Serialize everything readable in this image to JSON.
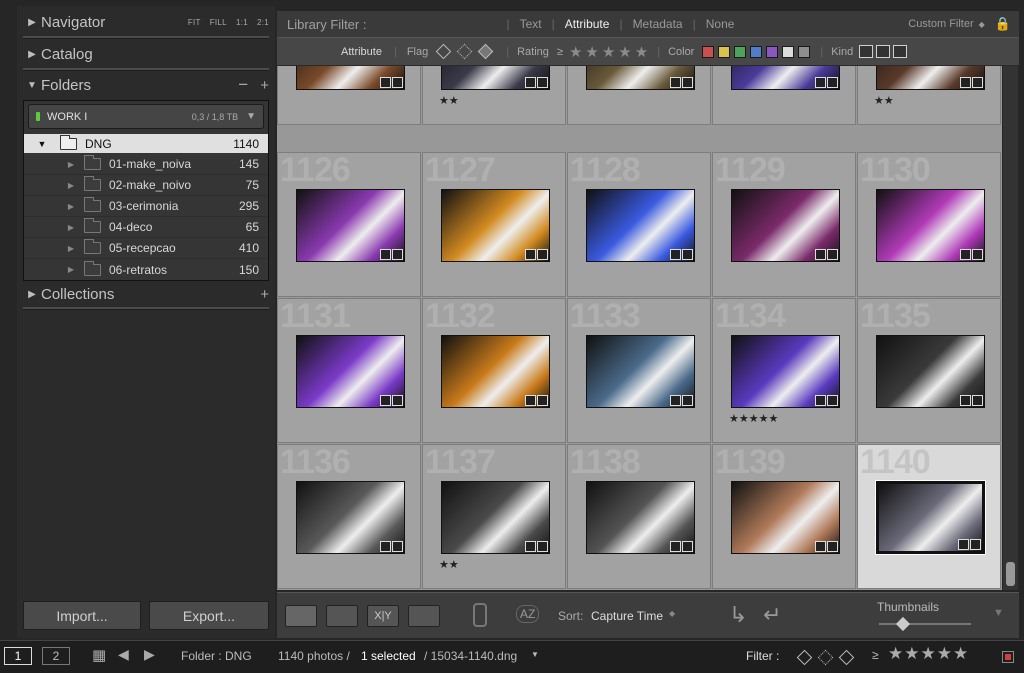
{
  "nav": {
    "navigator": "Navigator",
    "nav_opts": [
      "FIT",
      "FILL",
      "1:1",
      "2:1"
    ],
    "catalog": "Catalog",
    "folders": "Folders",
    "collections": "Collections"
  },
  "volume": {
    "name": "WORK I",
    "size": "0,3 / 1,8 TB"
  },
  "root_folder": {
    "name": "DNG",
    "count": "1140"
  },
  "subfolders": [
    {
      "name": "01-make_noiva",
      "count": "145"
    },
    {
      "name": "02-make_noivo",
      "count": "75"
    },
    {
      "name": "03-cerimonia",
      "count": "295"
    },
    {
      "name": "04-deco",
      "count": "65"
    },
    {
      "name": "05-recepcao",
      "count": "410"
    },
    {
      "name": "06-retratos",
      "count": "150"
    }
  ],
  "buttons": {
    "import": "Import...",
    "export": "Export..."
  },
  "filter_bar": {
    "title": "Library Filter :",
    "options": [
      "Text",
      "Attribute",
      "Metadata",
      "None"
    ],
    "active": "Attribute",
    "preset": "Custom Filter"
  },
  "attr_bar": {
    "attribute": "Attribute",
    "flag": "Flag",
    "rating": "Rating",
    "rating_op": "≥",
    "color": "Color",
    "kind": "Kind"
  },
  "colors": {
    "swatches": [
      "#c9504f",
      "#d9c34a",
      "#4fa25a",
      "#4f7dc9",
      "#8a57c2",
      "#dcdcdc",
      "#8e8e8e"
    ]
  },
  "grid": {
    "rows": [
      [
        {
          "num": "",
          "stars": ""
        },
        {
          "num": "",
          "stars": "★★"
        },
        {
          "num": "",
          "stars": ""
        },
        {
          "num": "",
          "stars": ""
        },
        {
          "num": "",
          "stars": "★★"
        }
      ],
      [
        {
          "num": "1126",
          "stars": ""
        },
        {
          "num": "1127",
          "stars": ""
        },
        {
          "num": "1128",
          "stars": ""
        },
        {
          "num": "1129",
          "stars": ""
        },
        {
          "num": "1130",
          "stars": ""
        }
      ],
      [
        {
          "num": "1131",
          "stars": ""
        },
        {
          "num": "1132",
          "stars": ""
        },
        {
          "num": "1133",
          "stars": ""
        },
        {
          "num": "1134",
          "stars": "★★★★★"
        },
        {
          "num": "1135",
          "stars": ""
        }
      ],
      [
        {
          "num": "1136",
          "stars": ""
        },
        {
          "num": "1137",
          "stars": "★★"
        },
        {
          "num": "1138",
          "stars": ""
        },
        {
          "num": "1139",
          "stars": ""
        },
        {
          "num": "1140",
          "stars": ""
        }
      ]
    ],
    "thumb_colors": [
      [
        "#7a4a2a",
        "#3a3a4a",
        "#6a5a3a",
        "#4a3a9a",
        "#5a3a2a"
      ],
      [
        "#8a3ab0",
        "#d28a20",
        "#3a5ae0",
        "#7a2a6a",
        "#b03ab8"
      ],
      [
        "#7a3ac8",
        "#c87a1a",
        "#4a6a8a",
        "#5a3ac0",
        "#3a3a3a"
      ],
      [
        "#5a5a5a",
        "#4a4a4a",
        "#545454",
        "#b07a5a",
        "#6a6a7a"
      ]
    ]
  },
  "toolbar": {
    "sort_label": "Sort:",
    "sort_value": "Capture Time",
    "thumbnails": "Thumbnails"
  },
  "filmstrip": {
    "screen1": "1",
    "screen2": "2",
    "folder": "Folder : DNG",
    "photos": "1140 photos /",
    "selected": "1 selected",
    "file": "/ 15034-1140.dng",
    "filter": "Filter :",
    "rating_op": "≥"
  }
}
